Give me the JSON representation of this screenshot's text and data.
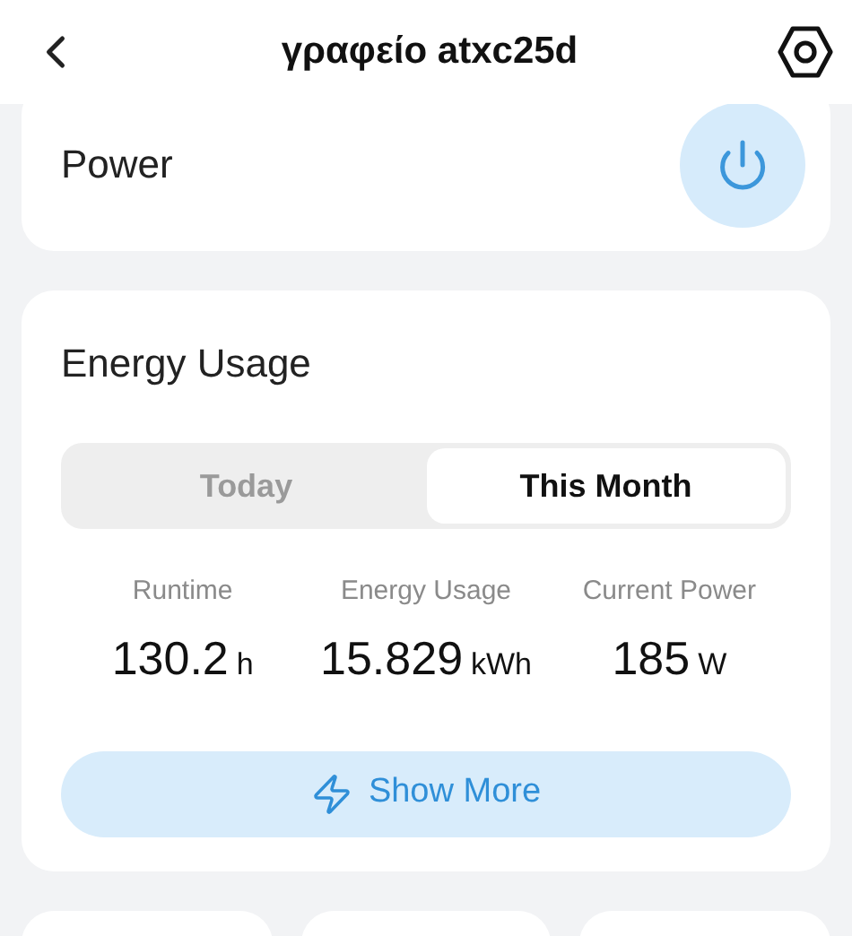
{
  "header": {
    "title": "γραφείο atxc25d"
  },
  "power_card": {
    "label": "Power"
  },
  "energy_card": {
    "title": "Energy Usage",
    "tabs": [
      {
        "label": "Today",
        "selected": false
      },
      {
        "label": "This Month",
        "selected": true
      }
    ],
    "stats": [
      {
        "label": "Runtime",
        "value": "130.2",
        "unit": "h"
      },
      {
        "label": "Energy Usage",
        "value": "15.829",
        "unit": "kWh"
      },
      {
        "label": "Current Power",
        "value": "185",
        "unit": "W"
      }
    ],
    "button": {
      "label": "Show More"
    }
  }
}
